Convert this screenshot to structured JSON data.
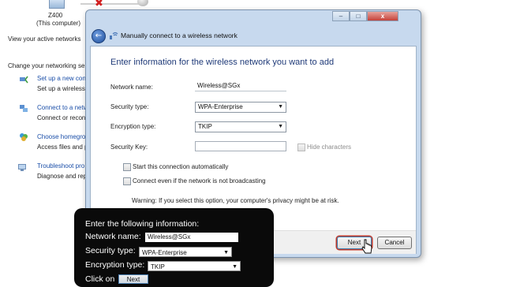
{
  "background": {
    "computer_name": "Z400",
    "computer_sub": "(This computer)",
    "view_active": "View your active networks",
    "change_settings": "Change your networking se",
    "tasks": [
      {
        "link": "Set up a new con",
        "desc": "Set up a wireless, b",
        "icon": "network-setup-icon"
      },
      {
        "link": "Connect to a netw",
        "desc": "Connect or recon",
        "icon": "connect-network-icon"
      },
      {
        "link": "Choose homegro",
        "desc": "Access files and p",
        "icon": "homegroup-icon"
      },
      {
        "link": "Troubleshoot pro",
        "desc": "Diagnose and rep",
        "icon": "troubleshoot-icon"
      }
    ]
  },
  "dialog": {
    "title": "Manually connect to a wireless network",
    "heading": "Enter information for the wireless network you want to add",
    "labels": {
      "network_name": "Network name:",
      "security_type": "Security type:",
      "encryption_type": "Encryption type:",
      "security_key": "Security Key:"
    },
    "values": {
      "network_name": "Wireless@SGx",
      "security_type": "WPA-Enterprise",
      "encryption_type": "TKIP",
      "security_key": ""
    },
    "hide_characters": "Hide characters",
    "start_auto": "Start this connection automatically",
    "connect_even": "Connect even if the network is not broadcasting",
    "warning": "Warning: If you select this option, your computer's privacy might be at risk.",
    "next_label": "Next",
    "cancel_label": "Cancel",
    "window_controls": {
      "minimize": "–",
      "maximize": "□",
      "close": "x"
    }
  },
  "overlay": {
    "title": "Enter the following information:",
    "network_name_label": "Network name:",
    "network_name_value": "Wireless@SGx",
    "security_type_label": "Security type:",
    "security_type_value": "WPA-Enterprise",
    "encryption_type_label": "Encryption type:",
    "encryption_type_value": "TKIP",
    "click_on": "Click on",
    "next_label": "Next"
  },
  "colors": {
    "accent_blue": "#1a4ea8",
    "heading_blue": "#1f3a78",
    "highlight_red": "#c0392b",
    "overlay_bg": "#0a0a0a"
  }
}
